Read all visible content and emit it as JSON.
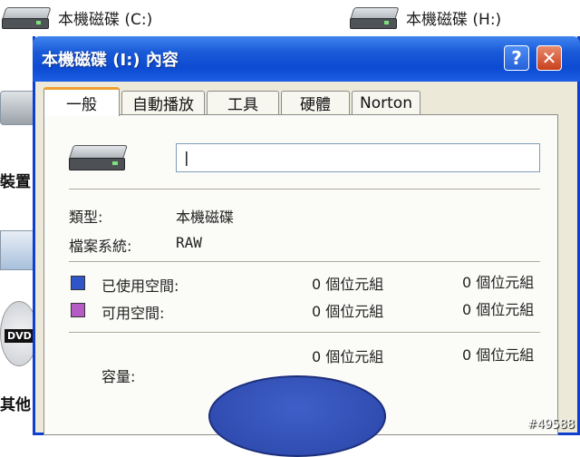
{
  "background": {
    "drives": [
      {
        "label": "本機磁碟 (C:)"
      },
      {
        "label": "本機磁碟 (H:)"
      }
    ],
    "left_labels": [
      "裝置",
      "其他"
    ],
    "dvd_label": "DVD"
  },
  "dialog": {
    "title": "本機磁碟 (I:) 內容",
    "help_glyph": "?",
    "close_glyph": "✕",
    "tabs": [
      "一般",
      "自動播放",
      "工具",
      "硬體",
      "Norton"
    ],
    "active_tab": 0,
    "name_input_value": "",
    "type_label": "類型:",
    "type_value": "本機磁碟",
    "fs_label": "檔案系統:",
    "fs_value": "RAW",
    "used_label": "已使用空間:",
    "used_bytes": "0 個位元組",
    "used_bytes_2": "0 個位元組",
    "free_label": "可用空間:",
    "free_bytes": "0 個位元組",
    "free_bytes_2": "0 個位元組",
    "capacity_label": "容量:",
    "capacity_bytes": "0 個位元組",
    "capacity_bytes_2": "0 個位元組"
  },
  "colors": {
    "used": "#2f55c8",
    "free": "#b45cc4"
  },
  "watermark": "#49588"
}
